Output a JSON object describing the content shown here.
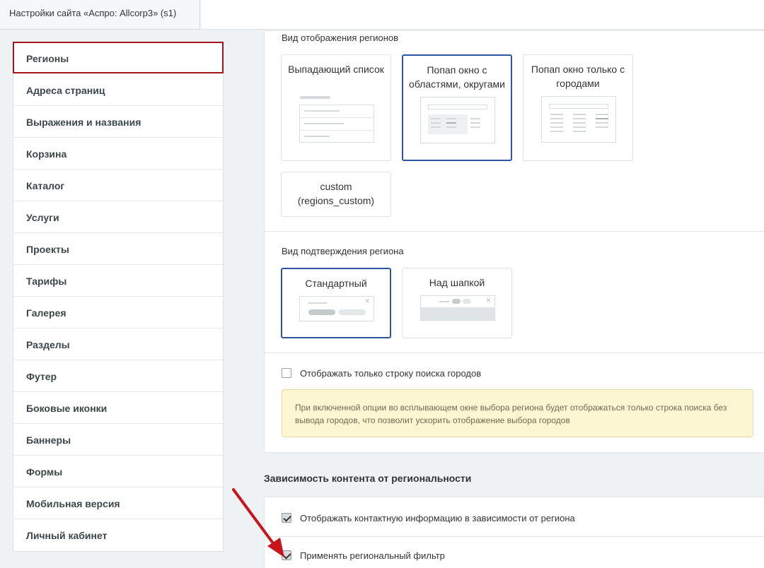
{
  "top_tab": {
    "title": "Настройки сайта «Аспро: Allcorp3» (s1)"
  },
  "sidebar": {
    "items": [
      {
        "label": "Регионы",
        "active": true
      },
      {
        "label": "Адреса страниц"
      },
      {
        "label": "Выражения и названия"
      },
      {
        "label": "Корзина"
      },
      {
        "label": "Каталог"
      },
      {
        "label": "Услуги"
      },
      {
        "label": "Проекты"
      },
      {
        "label": "Тарифы"
      },
      {
        "label": "Галерея"
      },
      {
        "label": "Разделы"
      },
      {
        "label": "Футер"
      },
      {
        "label": "Боковые иконки"
      },
      {
        "label": "Баннеры"
      },
      {
        "label": "Формы"
      },
      {
        "label": "Мобильная версия"
      },
      {
        "label": "Личный кабинет"
      }
    ]
  },
  "region_view": {
    "label": "Вид отображения регионов",
    "options": [
      {
        "title": "Выпадающий список",
        "selected": false
      },
      {
        "title": "Попап окно с областями, округами",
        "selected": true
      },
      {
        "title": "Попап окно только с городами",
        "selected": false
      },
      {
        "title": "custom (regions_custom)",
        "selected": false
      }
    ]
  },
  "region_confirm": {
    "label": "Вид подтверждения региона",
    "options": [
      {
        "title": "Стандартный",
        "selected": true
      },
      {
        "title": "Над шапкой",
        "selected": false
      }
    ]
  },
  "search_only": {
    "label": "Отображать только строку поиска городов",
    "checked": false,
    "note": "При включенной опции во всплывающем окне выбора региона будет отображаться только строка поиска без вывода городов, что позволит ускорить отображение выбора городов"
  },
  "regional_content": {
    "heading": "Зависимость контента от региональности",
    "contact_info": {
      "label": "Отображать контактную информацию в зависимости от региона",
      "checked": true
    },
    "regional_filter": {
      "label": "Применять региональный фильтр",
      "checked": true
    }
  },
  "colors": {
    "accent_active": "#a3151b",
    "selected_border": "#2f54a6",
    "arrow": "#c8141b",
    "note_bg": "#fcf6d3"
  }
}
